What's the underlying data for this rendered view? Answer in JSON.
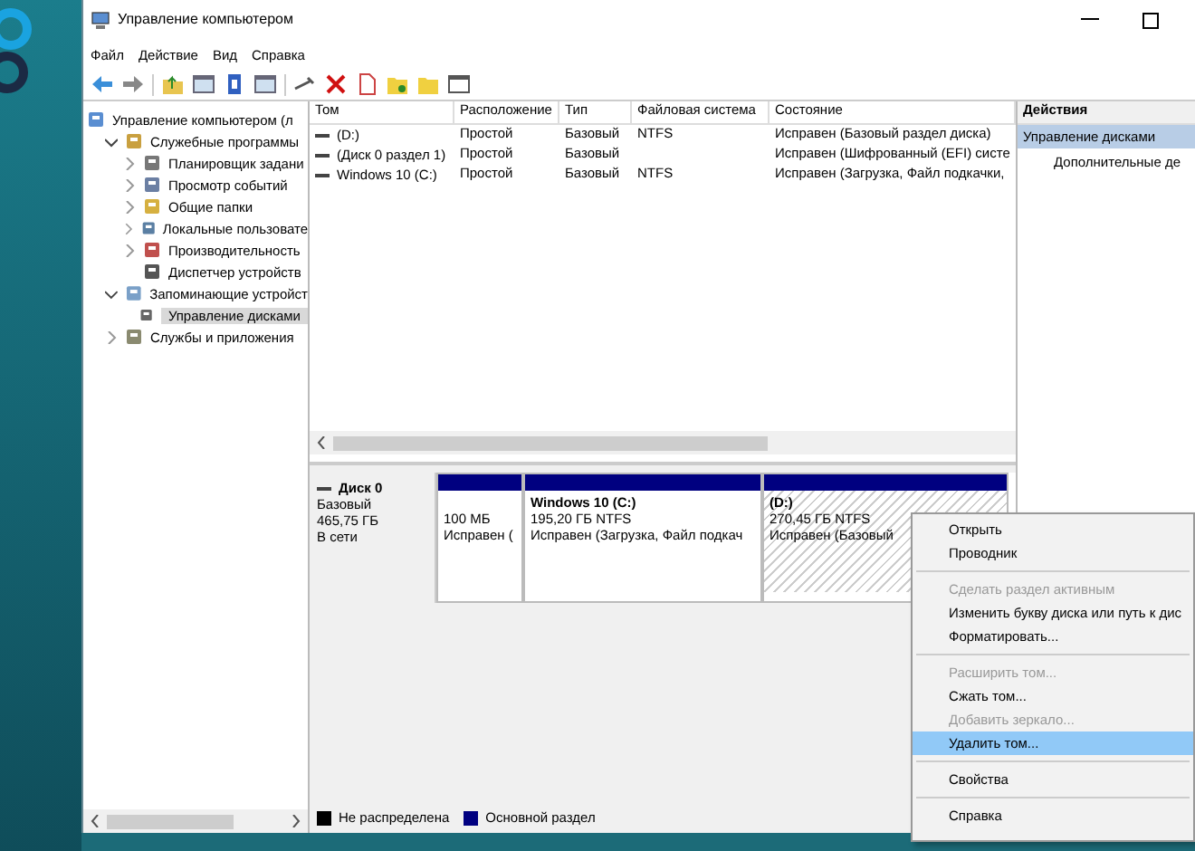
{
  "window": {
    "title": "Управление компьютером"
  },
  "menu": [
    "Файл",
    "Действие",
    "Вид",
    "Справка"
  ],
  "tree": [
    {
      "label": "Управление компьютером (л",
      "kind": "root",
      "selected": false,
      "children": [
        {
          "label": "Служебные программы",
          "kind": "branch",
          "expanded": true,
          "selected": false,
          "children": [
            {
              "label": "Планировщик задани",
              "kind": "branch",
              "expanded": false,
              "selected": false
            },
            {
              "label": "Просмотр событий",
              "kind": "branch",
              "expanded": false,
              "selected": false
            },
            {
              "label": "Общие папки",
              "kind": "branch",
              "expanded": false,
              "selected": false
            },
            {
              "label": "Локальные пользовате",
              "kind": "branch",
              "expanded": false,
              "selected": false
            },
            {
              "label": "Производительность",
              "kind": "branch",
              "expanded": false,
              "selected": false
            },
            {
              "label": "Диспетчер устройств",
              "kind": "leaf",
              "expanded": false,
              "selected": false
            }
          ]
        },
        {
          "label": "Запоминающие устройст",
          "kind": "branch",
          "expanded": true,
          "selected": false,
          "children": [
            {
              "label": "Управление дисками",
              "kind": "leaf",
              "expanded": false,
              "selected": true
            }
          ]
        },
        {
          "label": "Службы и приложения",
          "kind": "branch",
          "expanded": false,
          "selected": false
        }
      ]
    }
  ],
  "table": {
    "columns": [
      "Том",
      "Расположение",
      "Тип",
      "Файловая система",
      "Состояние"
    ],
    "rows": [
      [
        "(D:)",
        "Простой",
        "Базовый",
        "NTFS",
        "Исправен (Базовый раздел диска)"
      ],
      [
        "(Диск 0 раздел 1)",
        "Простой",
        "Базовый",
        "",
        "Исправен (Шифрованный (EFI) систе"
      ],
      [
        "Windows 10 (C:)",
        "Простой",
        "Базовый",
        "NTFS",
        "Исправен (Загрузка, Файл подкачки,"
      ]
    ]
  },
  "disk": {
    "name": "Диск 0",
    "type": "Базовый",
    "size": "465,75 ГБ",
    "status": "В сети",
    "partitions": [
      {
        "lines": [
          "100 МБ",
          "Исправен ("
        ],
        "selected": false
      },
      {
        "title": "Windows 10  (C:)",
        "lines": [
          "195,20 ГБ NTFS",
          "Исправен (Загрузка, Файл подкач"
        ],
        "selected": false
      },
      {
        "title": "(D:)",
        "lines": [
          "270,45 ГБ NTFS",
          "Исправен (Базовый"
        ],
        "selected": true
      }
    ]
  },
  "legend": [
    {
      "label": "Не распределена",
      "color": "#000000"
    },
    {
      "label": "Основной раздел",
      "color": "#000080"
    }
  ],
  "actions": {
    "title": "Действия",
    "items": [
      {
        "label": "Управление дисками",
        "kind": "group",
        "selected": true
      },
      {
        "label": "Дополнительные де",
        "kind": "item",
        "selected": false
      }
    ]
  },
  "context_menu": [
    {
      "kind": "item",
      "label": "Открыть",
      "disabled": false,
      "selected": false
    },
    {
      "kind": "item",
      "label": "Проводник",
      "disabled": false,
      "selected": false
    },
    {
      "kind": "separator"
    },
    {
      "kind": "item",
      "label": "Сделать раздел активным",
      "disabled": true,
      "selected": false
    },
    {
      "kind": "item",
      "label": "Изменить букву диска или путь к дис",
      "disabled": false,
      "selected": false
    },
    {
      "kind": "item",
      "label": "Форматировать...",
      "disabled": false,
      "selected": false
    },
    {
      "kind": "separator"
    },
    {
      "kind": "item",
      "label": "Расширить том...",
      "disabled": true,
      "selected": false
    },
    {
      "kind": "item",
      "label": "Сжать том...",
      "disabled": false,
      "selected": false
    },
    {
      "kind": "item",
      "label": "Добавить зеркало...",
      "disabled": true,
      "selected": false
    },
    {
      "kind": "item",
      "label": "Удалить том...",
      "disabled": false,
      "selected": true
    },
    {
      "kind": "separator"
    },
    {
      "kind": "item",
      "label": "Свойства",
      "disabled": false,
      "selected": false
    },
    {
      "kind": "separator"
    },
    {
      "kind": "item",
      "label": "Справка",
      "disabled": false,
      "selected": false
    }
  ]
}
